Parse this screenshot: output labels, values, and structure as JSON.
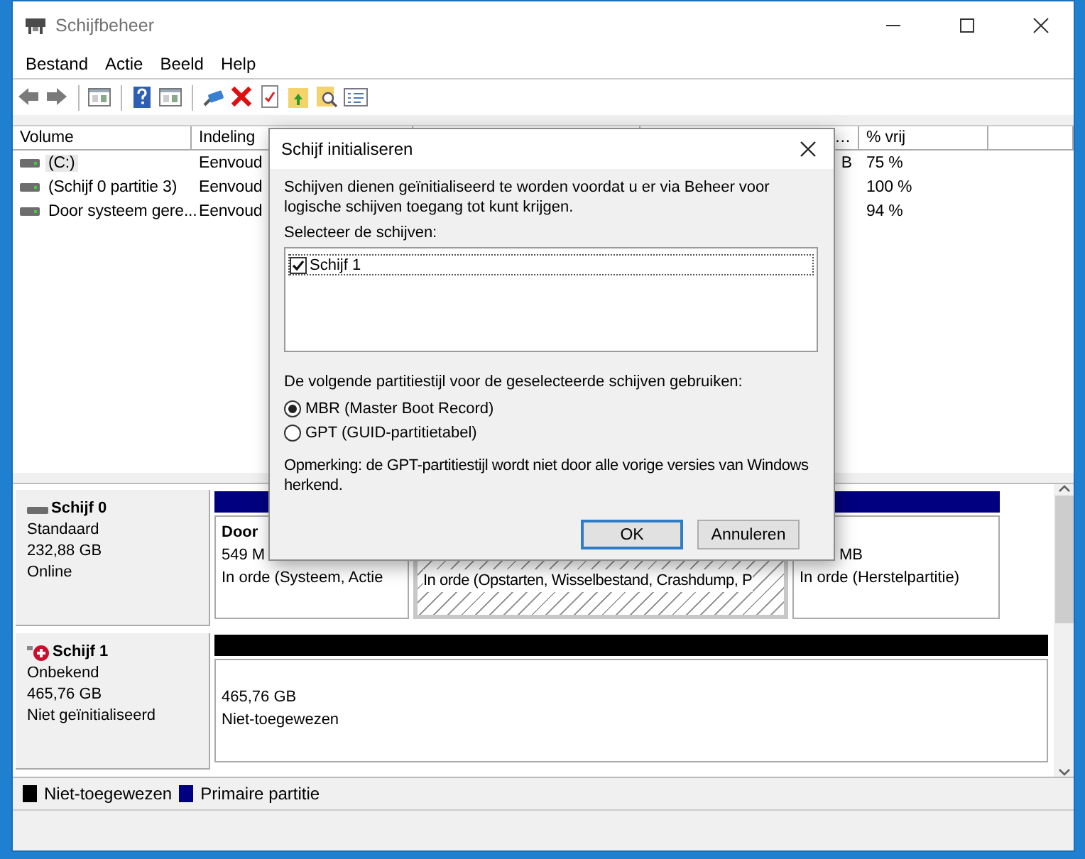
{
  "window": {
    "title": "Schijfbeheer"
  },
  "menu": [
    "Bestand",
    "Actie",
    "Beeld",
    "Help"
  ],
  "volumes": {
    "columns": [
      {
        "label": "Volume",
        "kind": "text"
      },
      {
        "label": "Indeling",
        "kind": "text"
      },
      {
        "kind": "hidden"
      },
      {
        "label": "…",
        "kind": "number"
      },
      {
        "label": "% vrij",
        "kind": "text"
      }
    ],
    "rows": [
      {
        "volume": "(C:)",
        "indeling": "Eenvoud",
        "column_4": "B",
        "vrij": "75 %",
        "selected": true
      },
      {
        "volume": "(Schijf 0 partitie 3)",
        "indeling": "Eenvoud",
        "vrij": "100 %",
        "selected": false
      },
      {
        "volume": "Door systeem gere...",
        "indeling": "Eenvoud",
        "vrij": "94 %",
        "selected": false
      }
    ]
  },
  "disks": [
    {
      "name": "Schijf 0",
      "kind": "basic",
      "type": "Standaard",
      "size": "232,88 GB",
      "status": "Online",
      "partitions": [
        {
          "title": "Door",
          "size": "549 M",
          "status": "In orde (Systeem, Actie",
          "color": "#000080",
          "selected": false
        },
        {
          "status": "In orde (Opstarten, Wisselbestand, Crashdump, P",
          "selected": true
        },
        {
          "size": "MB",
          "status": "In orde (Herstelpartitie)",
          "color": "#000080",
          "selected": false
        }
      ]
    },
    {
      "name": "Schijf 1",
      "kind": "unknown",
      "type": "Onbekend",
      "size": "465,76 GB",
      "status": "Niet geïnitialiseerd",
      "partitions": [
        {
          "size": "465,76 GB",
          "status": "Niet-toegewezen",
          "color": "#000000",
          "selected": false
        }
      ]
    }
  ],
  "legend": [
    {
      "label": "Niet-toegewezen",
      "color": "#000000"
    },
    {
      "label": "Primaire partitie",
      "color": "#000080"
    }
  ],
  "dialog": {
    "title": "Schijf initialiseren",
    "intro": "Schijven dienen geïnitialiseerd te worden voordat u er via Beheer voor logische schijven toegang tot kunt krijgen.",
    "list_label": "Selecteer de schijven:",
    "disks": [
      {
        "label": "Schijf 1",
        "checked": true
      }
    ],
    "style_label": "De volgende partitiestijl voor de geselecteerde schijven gebruiken:",
    "styles": [
      {
        "label": "MBR (Master Boot Record)",
        "selected": true
      },
      {
        "label": "GPT (GUID-partitietabel)",
        "selected": false
      }
    ],
    "note": "Opmerking: de GPT-partitiestijl wordt niet door alle vorige versies van Windows herkend.",
    "buttons": [
      {
        "label": "OK",
        "default": true
      },
      {
        "label": "Annuleren",
        "default": false
      }
    ]
  }
}
